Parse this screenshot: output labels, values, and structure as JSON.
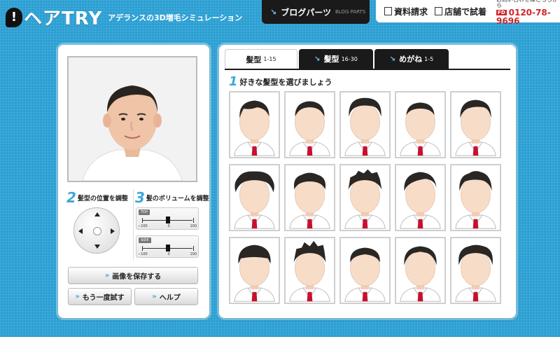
{
  "header": {
    "logo_mark": "!",
    "logo_text": "ヘアTRY",
    "tagline": "アデランスの3D増毛シミュレーション",
    "blog_tab": {
      "label": "ブログパーツ",
      "sub": "BLOG PARTS"
    },
    "links": [
      {
        "label": "資料請求"
      },
      {
        "label": "店舗で試着"
      }
    ],
    "phone": {
      "label": "お問い合わせはこちらから",
      "badge": "FD",
      "number": "0120-78-9696"
    }
  },
  "left": {
    "position": {
      "num": "2",
      "label": "髪型の位置を調整"
    },
    "volume": {
      "num": "3",
      "label": "髪のボリュームを調整"
    },
    "sliders": [
      {
        "tag": "TOP",
        "min": "−100",
        "mid": "0",
        "max": "100",
        "value": 0
      },
      {
        "tag": "SIDE",
        "min": "−100",
        "mid": "0",
        "max": "100",
        "value": 0
      }
    ],
    "buttons": {
      "save": "画像を保存する",
      "retry": "もう一度試す",
      "help": "ヘルプ"
    }
  },
  "right": {
    "tabs": [
      {
        "label": "髪型",
        "range": "1-15",
        "active": true
      },
      {
        "label": "髪型",
        "range": "16-30",
        "active": false
      },
      {
        "label": "めがね",
        "range": "1-5",
        "active": false
      }
    ],
    "heading": {
      "num": "1",
      "label": "好きな髪型を選びましょう"
    },
    "styles": [
      {
        "style": "side-part"
      },
      {
        "style": "short-neat"
      },
      {
        "style": "volume-top"
      },
      {
        "style": "short-crop"
      },
      {
        "style": "side-part-dark"
      },
      {
        "style": "messy-wide"
      },
      {
        "style": "curly-short"
      },
      {
        "style": "spiky-volume"
      },
      {
        "style": "swept"
      },
      {
        "style": "textured"
      },
      {
        "style": "bowl"
      },
      {
        "style": "spiky-tall"
      },
      {
        "style": "short-rounded"
      },
      {
        "style": "middle-part"
      },
      {
        "style": "wavy-medium"
      }
    ]
  },
  "colors": {
    "background": "#2b9fd3",
    "accent": "#3fa8d9",
    "tie": "#c8102e",
    "phone": "#d2232a"
  }
}
